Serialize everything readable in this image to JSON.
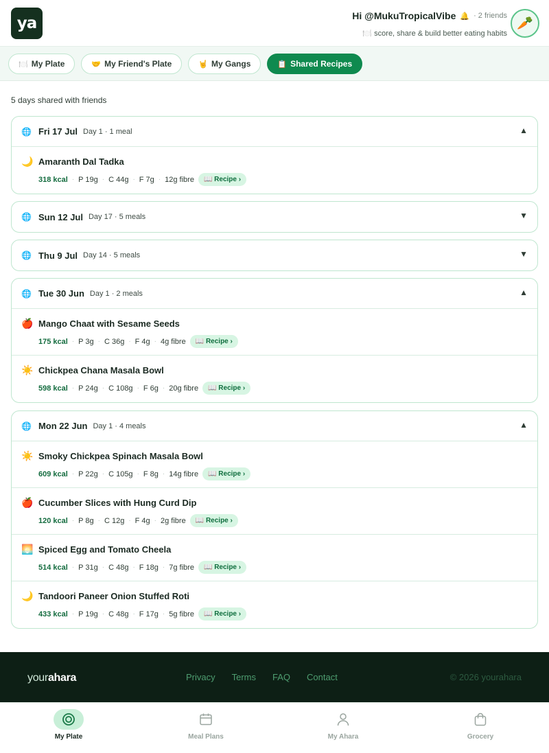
{
  "header": {
    "logo_text": "ya",
    "greeting": "Hi @MukuTropicalVibe",
    "bell_icon": "🔔",
    "friends": "· 2 friends",
    "tagline": "🍽️ score, share & build better eating habits",
    "avatar_icon": "🥕"
  },
  "tabs": [
    {
      "icon": "🍽️",
      "label": "My Plate",
      "active": false
    },
    {
      "icon": "🤝",
      "label": "My Friend's Plate",
      "active": false
    },
    {
      "icon": "🤘",
      "label": "My Gangs",
      "active": false
    },
    {
      "icon": "📋",
      "label": "Shared Recipes",
      "active": true
    }
  ],
  "summary": "5 days shared with friends",
  "recipe_chip_label": "📖 Recipe ›",
  "days": [
    {
      "date": "Fri 17 Jul",
      "meta": "Day 1 · 1 meal",
      "expanded": true,
      "chevron": "▲",
      "meals": [
        {
          "icon": "🌙",
          "name": "Amaranth Dal Tadka",
          "kcal": "318 kcal",
          "p": "P 19g",
          "c": "C 44g",
          "f": "F 7g",
          "fibre": "12g fibre"
        }
      ]
    },
    {
      "date": "Sun 12 Jul",
      "meta": "Day 17 · 5 meals",
      "expanded": false,
      "chevron": "▼",
      "meals": []
    },
    {
      "date": "Thu 9 Jul",
      "meta": "Day 14 · 5 meals",
      "expanded": false,
      "chevron": "▼",
      "meals": []
    },
    {
      "date": "Tue 30 Jun",
      "meta": "Day 1 · 2 meals",
      "expanded": true,
      "chevron": "▲",
      "meals": [
        {
          "icon": "🍎",
          "name": "Mango Chaat with Sesame Seeds",
          "kcal": "175 kcal",
          "p": "P 3g",
          "c": "C 36g",
          "f": "F 4g",
          "fibre": "4g fibre"
        },
        {
          "icon": "☀️",
          "name": "Chickpea Chana Masala Bowl",
          "kcal": "598 kcal",
          "p": "P 24g",
          "c": "C 108g",
          "f": "F 6g",
          "fibre": "20g fibre"
        }
      ]
    },
    {
      "date": "Mon 22 Jun",
      "meta": "Day 1 · 4 meals",
      "expanded": true,
      "chevron": "▲",
      "meals": [
        {
          "icon": "☀️",
          "name": "Smoky Chickpea Spinach Masala Bowl",
          "kcal": "609 kcal",
          "p": "P 22g",
          "c": "C 105g",
          "f": "F 8g",
          "fibre": "14g fibre"
        },
        {
          "icon": "🍎",
          "name": "Cucumber Slices with Hung Curd Dip",
          "kcal": "120 kcal",
          "p": "P 8g",
          "c": "C 12g",
          "f": "F 4g",
          "fibre": "2g fibre"
        },
        {
          "icon": "🌅",
          "name": "Spiced Egg and Tomato Cheela",
          "kcal": "514 kcal",
          "p": "P 31g",
          "c": "C 48g",
          "f": "F 18g",
          "fibre": "7g fibre"
        },
        {
          "icon": "🌙",
          "name": "Tandoori Paneer Onion Stuffed Roti",
          "kcal": "433 kcal",
          "p": "P 19g",
          "c": "C 48g",
          "f": "F 17g",
          "fibre": "5g fibre"
        }
      ]
    }
  ],
  "footer": {
    "brand_part1": "your",
    "brand_part2": "ahara",
    "links": [
      "Privacy",
      "Terms",
      "FAQ",
      "Contact"
    ],
    "copyright": "© 2026 yourahara"
  },
  "bottom_nav": [
    {
      "label": "My Plate",
      "icon": "target-icon",
      "active": true
    },
    {
      "label": "Meal Plans",
      "icon": "calendar-icon",
      "active": false
    },
    {
      "label": "My Ahara",
      "icon": "person-icon",
      "active": false
    },
    {
      "label": "Grocery",
      "icon": "bag-icon",
      "active": false
    }
  ]
}
